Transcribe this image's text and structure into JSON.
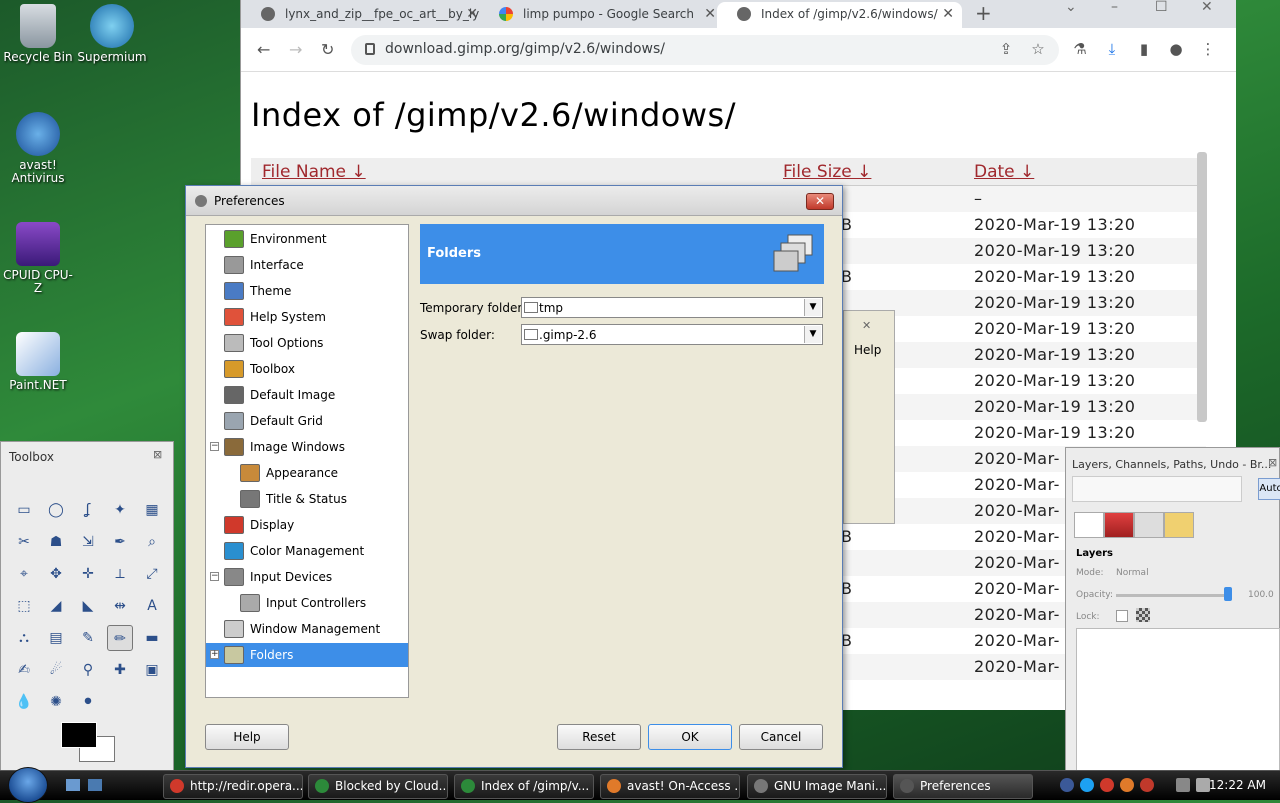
{
  "desktop": {
    "icons": [
      {
        "label": "Recycle Bin"
      },
      {
        "label": "Supermium"
      },
      {
        "label": "avast! Antivirus"
      },
      {
        "label": "CPUID CPU-Z"
      },
      {
        "label": "Paint.NET"
      }
    ]
  },
  "browser": {
    "tabs": [
      {
        "label": "lynx_and_zip__fpe_oc_art__by_ly"
      },
      {
        "label": "limp pumpo - Google Search"
      },
      {
        "label": "Index of /gimp/v2.6/windows/"
      }
    ],
    "url": "download.gimp.org/gimp/v2.6/windows/",
    "page_title": "Index of /gimp/v2.6/windows/",
    "listing": {
      "headers": {
        "name": "File Name ↓",
        "size": "File Size ↓",
        "date": "Date ↓"
      },
      "rows": [
        {
          "size": "",
          "date": "–"
        },
        {
          "size": "B",
          "date": "2020-Mar-19 13:20"
        },
        {
          "size": "",
          "date": "2020-Mar-19 13:20"
        },
        {
          "size": "B",
          "date": "2020-Mar-19 13:20"
        },
        {
          "size": "",
          "date": "2020-Mar-19 13:20"
        },
        {
          "size": "",
          "date": "2020-Mar-19 13:20"
        },
        {
          "size": "",
          "date": "2020-Mar-19 13:20"
        },
        {
          "size": "",
          "date": "2020-Mar-19 13:20"
        },
        {
          "size": "",
          "date": "2020-Mar-19 13:20"
        },
        {
          "size": "",
          "date": "2020-Mar-19 13:20"
        },
        {
          "size": "",
          "date": "2020-Mar-"
        },
        {
          "size": "",
          "date": "2020-Mar-"
        },
        {
          "size": "",
          "date": "2020-Mar-"
        },
        {
          "size": "B",
          "date": "2020-Mar-"
        },
        {
          "size": "",
          "date": "2020-Mar-"
        },
        {
          "size": "B",
          "date": "2020-Mar-"
        },
        {
          "size": "",
          "date": "2020-Mar-"
        },
        {
          "size": "B",
          "date": "2020-Mar-"
        },
        {
          "size": "",
          "date": "2020-Mar-"
        }
      ]
    }
  },
  "ghost_window": {
    "help_label": "Help"
  },
  "preferences": {
    "title": "Preferences",
    "tree": [
      {
        "label": "Environment",
        "indent": 0,
        "color": "#5aa02c"
      },
      {
        "label": "Interface",
        "indent": 0,
        "color": "#999999"
      },
      {
        "label": "Theme",
        "indent": 0,
        "color": "#4a7bc4"
      },
      {
        "label": "Help System",
        "indent": 0,
        "color": "#e0523a"
      },
      {
        "label": "Tool Options",
        "indent": 0,
        "color": "#bbbbbb"
      },
      {
        "label": "Toolbox",
        "indent": 0,
        "color": "#d79a2a"
      },
      {
        "label": "Default Image",
        "indent": 0,
        "color": "#666666"
      },
      {
        "label": "Default Grid",
        "indent": 0,
        "color": "#9aa5b0"
      },
      {
        "label": "Image Windows",
        "indent": 0,
        "color": "#8a6a3a",
        "expander": "−"
      },
      {
        "label": "Appearance",
        "indent": 1,
        "color": "#c88a3a"
      },
      {
        "label": "Title & Status",
        "indent": 1,
        "color": "#777777"
      },
      {
        "label": "Display",
        "indent": 0,
        "color": "#d0392b"
      },
      {
        "label": "Color Management",
        "indent": 0,
        "color": "#2a8fd0"
      },
      {
        "label": "Input Devices",
        "indent": 0,
        "color": "#888888",
        "expander": "−"
      },
      {
        "label": "Input Controllers",
        "indent": 1,
        "color": "#aaaaaa"
      },
      {
        "label": "Window Management",
        "indent": 0,
        "color": "#cccccc"
      },
      {
        "label": "Folders",
        "indent": 0,
        "color": "#c8c8a0",
        "expander": "+",
        "selected": true
      }
    ],
    "section_title": "Folders",
    "fields": [
      {
        "label": "Temporary folder:",
        "value": "tmp"
      },
      {
        "label": "Swap folder:",
        "value": ".gimp-2.6"
      }
    ],
    "buttons": {
      "help": "Help",
      "reset": "Reset",
      "ok": "OK",
      "cancel": "Cancel"
    }
  },
  "toolbox": {
    "title": "Toolbox"
  },
  "layers": {
    "title": "Layers, Channels, Paths, Undo - Br...",
    "auto_label": "Auto",
    "section": "Layers",
    "mode_label": "Mode:",
    "mode_value": "Normal",
    "opacity_label": "Opacity:",
    "opacity_value": "100.0",
    "lock_label": "Lock:"
  },
  "taskbar": {
    "buttons": [
      {
        "label": "http://redir.opera...",
        "color": "#d0392b"
      },
      {
        "label": "Blocked by Cloud...",
        "color": "#2c8a3a"
      },
      {
        "label": "Index of /gimp/v...",
        "color": "#2c8a3a"
      },
      {
        "label": "avast! On-Access ...",
        "color": "#e07a2a"
      },
      {
        "label": "GNU Image Mani...",
        "color": "#777777"
      },
      {
        "label": "Preferences",
        "color": "#555555",
        "active": true
      }
    ],
    "clock": "12:22 AM"
  }
}
